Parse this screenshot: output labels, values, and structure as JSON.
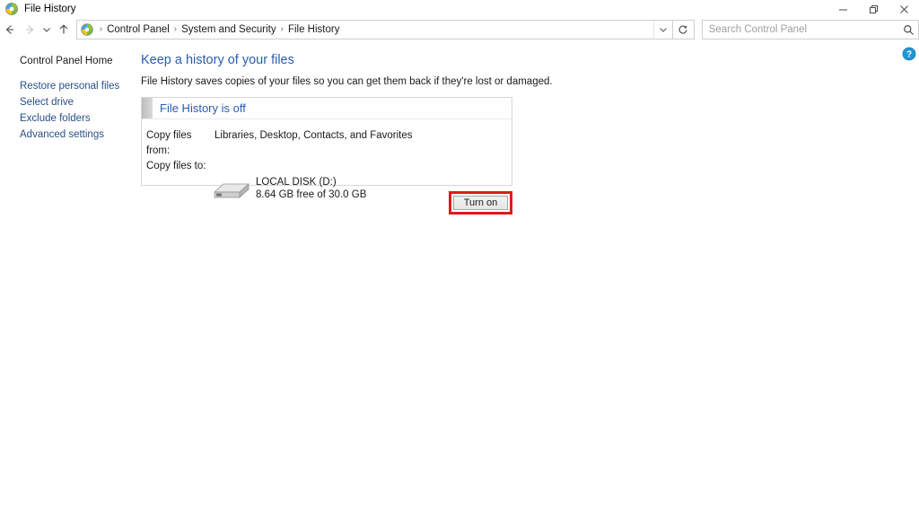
{
  "window": {
    "title": "File History",
    "icon": "file-history-icon",
    "controls": {
      "minimize": "Minimize",
      "restore": "Restore Down",
      "close": "Close"
    }
  },
  "toolbar": {
    "back": "Back",
    "forward": "Forward",
    "recent_locations": "Recent locations",
    "up": "Up one level",
    "address_icon": "control-panel-globe-icon",
    "breadcrumbs": [
      "Control Panel",
      "System and Security",
      "File History"
    ],
    "breadcrumb_separator": "›",
    "dropdown": "Previous locations",
    "refresh": "Refresh"
  },
  "search": {
    "placeholder": "Search Control Panel",
    "value": "",
    "icon": "search-icon"
  },
  "sidebar": {
    "home_label": "Control Panel Home",
    "items": [
      {
        "label": "Restore personal files"
      },
      {
        "label": "Select drive"
      },
      {
        "label": "Exclude folders"
      },
      {
        "label": "Advanced settings"
      }
    ]
  },
  "main": {
    "title": "Keep a history of your files",
    "description": "File History saves copies of your files so you can get them back if they're lost or damaged.",
    "help_icon": "help-icon",
    "status": {
      "heading": "File History is off",
      "copy_from_label": "Copy files from:",
      "copy_from_value": "Libraries, Desktop, Contacts, and Favorites",
      "copy_to_label": "Copy files to:",
      "drive_icon": "external-drive-icon",
      "drive_name": "LOCAL DISK (D:)",
      "drive_capacity": "8.64 GB free of 30.0 GB"
    },
    "turn_on_label": "Turn on"
  },
  "colors": {
    "link": "#2a4f84",
    "title": "#2a5db0",
    "highlight": "#e01b1b",
    "panel_border": "#d7d7d7",
    "help_blue": "#1a8fd8"
  }
}
